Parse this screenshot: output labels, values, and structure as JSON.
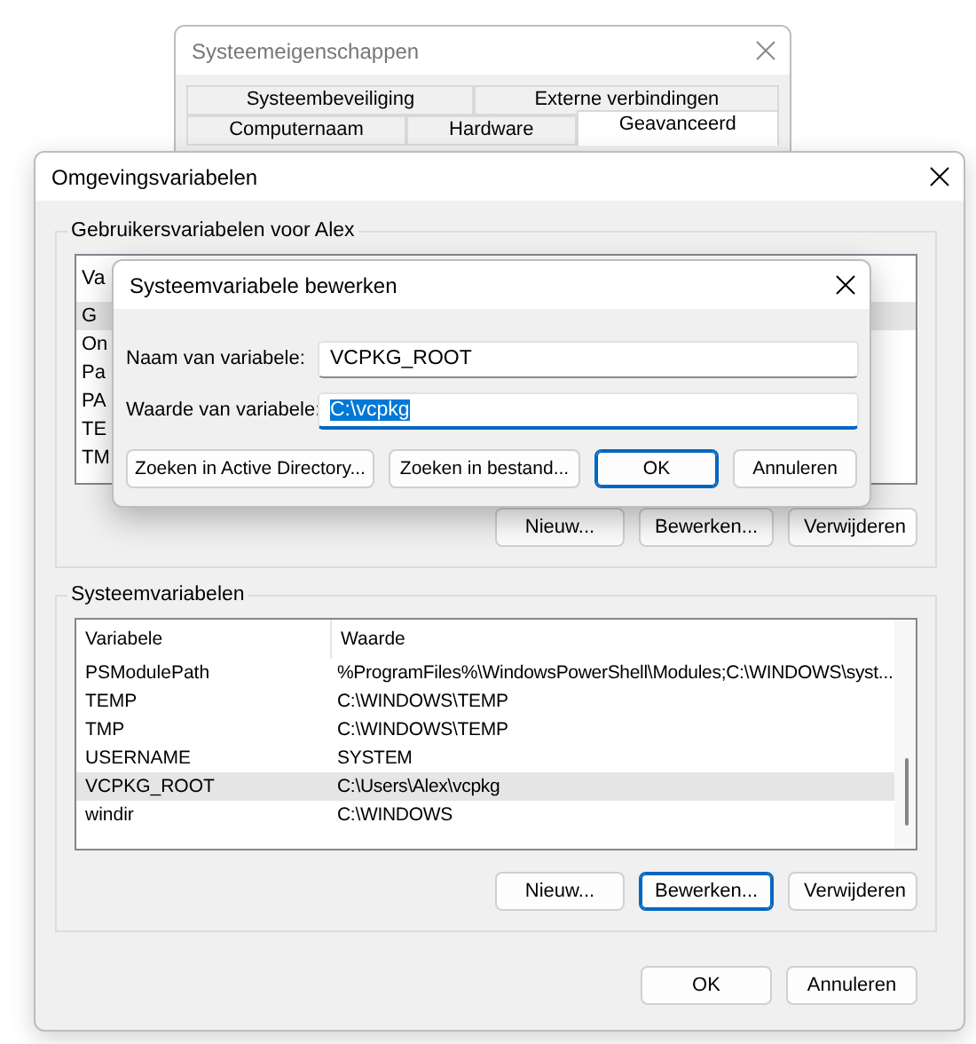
{
  "background_window": {
    "title": "Systeemeigenschappen",
    "tab_rows": [
      [
        {
          "label": "Systeembeveiliging",
          "selected": false
        },
        {
          "label": "Externe verbindingen",
          "selected": false
        }
      ],
      [
        {
          "label": "Computernaam",
          "selected": false
        },
        {
          "label": "Hardware",
          "selected": false
        },
        {
          "label": "Geavanceerd",
          "selected": true
        }
      ]
    ]
  },
  "main_window": {
    "title": "Omgevingsvariabelen",
    "user_variables": {
      "title": "Gebruikersvariabelen voor Alex",
      "header_fragment": "Va",
      "rows": [
        {
          "fragment": "G",
          "selected": true
        },
        {
          "fragment": "On",
          "selected": false
        },
        {
          "fragment": "Pa",
          "selected": false
        },
        {
          "fragment": "PA",
          "selected": false
        },
        {
          "fragment": "TE",
          "selected": false
        },
        {
          "fragment": "TM",
          "selected": false
        }
      ],
      "buttons": [
        {
          "label": "Nieuw...",
          "focused": false
        },
        {
          "label": "Bewerken...",
          "focused": false
        },
        {
          "label": "Verwijderen",
          "focused": false
        }
      ]
    },
    "system_variables": {
      "title": "Systeemvariabelen",
      "columns": [
        "Variabele",
        "Waarde"
      ],
      "rows": [
        {
          "variable": "PSModulePath",
          "value": "%ProgramFiles%\\WindowsPowerShell\\Modules;C:\\WINDOWS\\syst...",
          "selected": false
        },
        {
          "variable": "TEMP",
          "value": "C:\\WINDOWS\\TEMP",
          "selected": false
        },
        {
          "variable": "TMP",
          "value": "C:\\WINDOWS\\TEMP",
          "selected": false
        },
        {
          "variable": "USERNAME",
          "value": "SYSTEM",
          "selected": false
        },
        {
          "variable": "VCPKG_ROOT",
          "value": "C:\\Users\\Alex\\vcpkg",
          "selected": true
        },
        {
          "variable": "windir",
          "value": "C:\\WINDOWS",
          "selected": false
        }
      ],
      "buttons": [
        {
          "label": "Nieuw...",
          "focused": false
        },
        {
          "label": "Bewerken...",
          "focused": true
        },
        {
          "label": "Verwijderen",
          "focused": false
        }
      ]
    },
    "buttons": [
      {
        "label": "OK",
        "focused": false
      },
      {
        "label": "Annuleren",
        "focused": false
      }
    ]
  },
  "dialog": {
    "title": "Systeemvariabele bewerken",
    "fields": [
      {
        "label": "Naam van variabele:",
        "value": "VCPKG_ROOT",
        "focused": false,
        "value_selected": false
      },
      {
        "label": "Waarde van variabele:",
        "value": "C:\\vcpkg",
        "focused": true,
        "value_selected": true
      }
    ],
    "buttons": [
      {
        "label": "Zoeken in Active Directory...",
        "focused": false
      },
      {
        "label": "Zoeken in bestand...",
        "focused": false
      },
      {
        "label": "OK",
        "focused": true
      },
      {
        "label": "Annuleren",
        "focused": false
      }
    ]
  }
}
